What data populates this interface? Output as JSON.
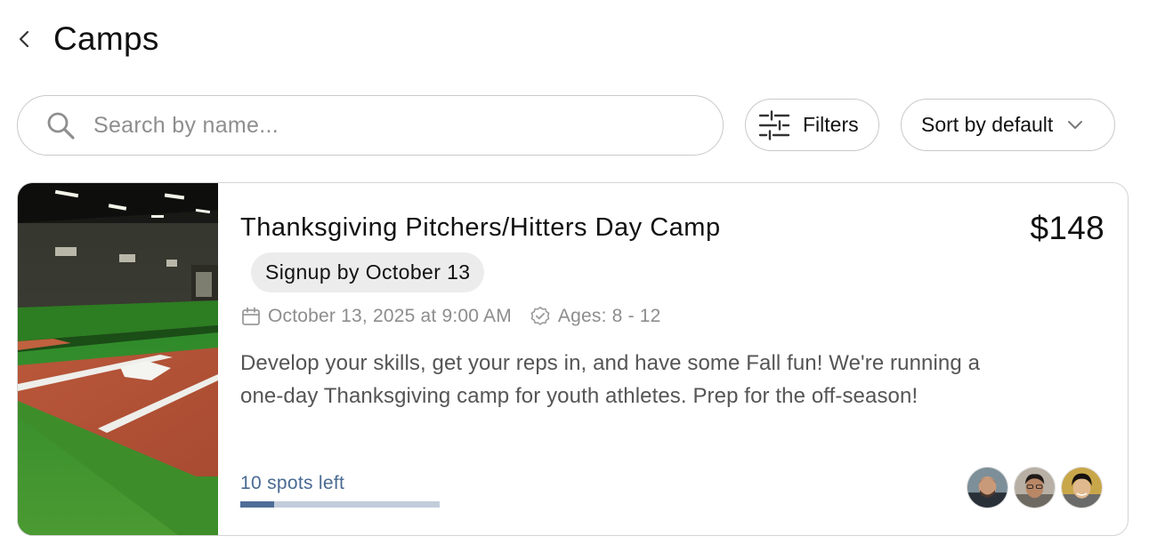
{
  "header": {
    "title": "Camps",
    "back_icon": "chevron-left-icon"
  },
  "search": {
    "placeholder": "Search by name...",
    "value": "",
    "icon": "search-icon"
  },
  "filters": {
    "label": "Filters",
    "icon": "sliders-icon"
  },
  "sort": {
    "label": "Sort by default",
    "icon": "chevron-down-icon"
  },
  "camp": {
    "title": "Thanksgiving Pitchers/Hitters Day Camp",
    "price": "$148",
    "signup_badge": "Signup by October 13",
    "date": "October 13, 2025 at 9:00 AM",
    "ages": "Ages: 8 - 12",
    "description": "Develop your skills, get your reps in, and have some Fall fun! We're running a one-day Thanksgiving camp for youth athletes. Prep for the off-season!",
    "spots_left": "10 spots left",
    "spots_progress_fraction": 0.17,
    "image": "indoor-baseball-facility-photo",
    "avatars": [
      "coach-avatar-1",
      "coach-avatar-2",
      "coach-avatar-3"
    ]
  },
  "colors": {
    "progress_fill": "#4f6d99",
    "progress_track": "#c3ccda",
    "spots_text": "#4a6a92",
    "badge_bg": "#ececec"
  }
}
